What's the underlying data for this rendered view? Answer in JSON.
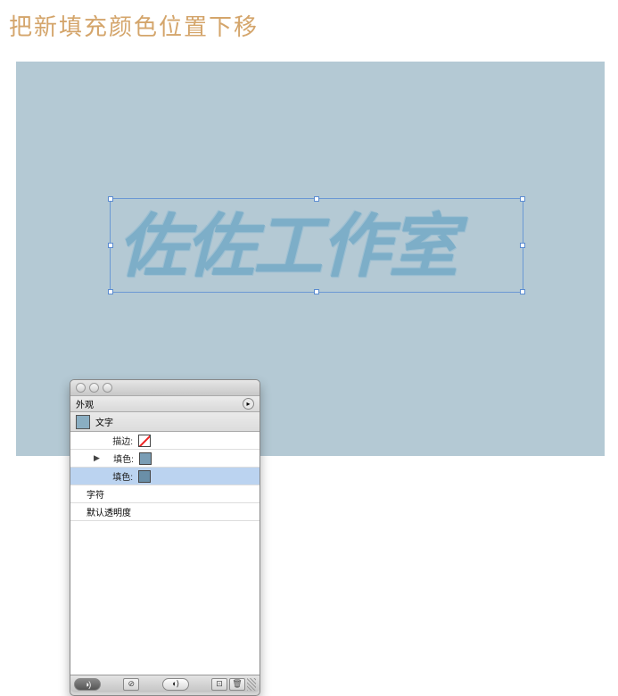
{
  "title": "把新填充颜色位置下移",
  "canvas": {
    "text": "佐佐工作室",
    "bg": "#b4c9d4"
  },
  "panel": {
    "tab_label": "外观",
    "header": {
      "label": "文字"
    },
    "rows": [
      {
        "label": "描边:",
        "swatch": "none",
        "indent": 1
      },
      {
        "label": "填色:",
        "swatch": "blue1",
        "indent": 1,
        "expandable": true
      },
      {
        "label": "填色:",
        "swatch": "blue2",
        "indent": 1,
        "selected": true
      },
      {
        "label": "字符",
        "indent": 0
      },
      {
        "label": "默认透明度",
        "indent": 0
      }
    ]
  }
}
